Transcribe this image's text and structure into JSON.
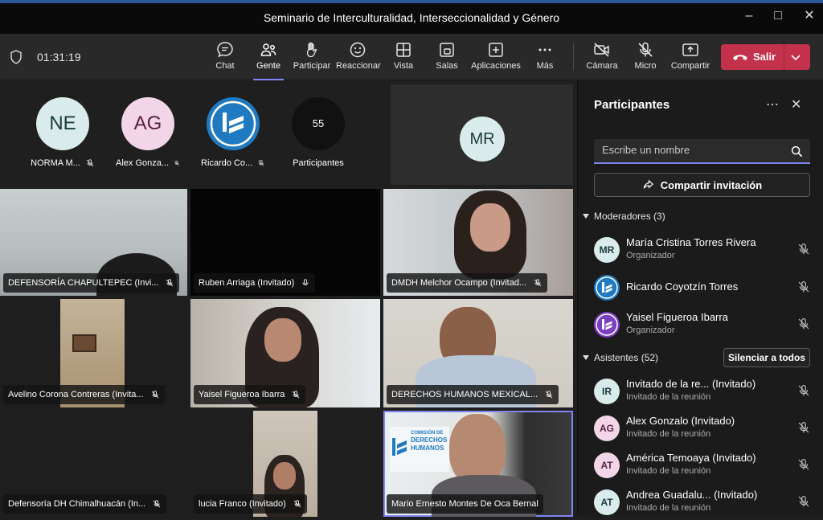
{
  "window": {
    "title": "Seminario de Interculturalidad, Interseccionalidad y Género"
  },
  "toolbar": {
    "timer": "01:31:19",
    "buttons": [
      {
        "label": "Chat",
        "icon": "chat-icon"
      },
      {
        "label": "Gente",
        "icon": "people-icon",
        "active": true
      },
      {
        "label": "Participar",
        "icon": "raise-hand-icon"
      },
      {
        "label": "Reaccionar",
        "icon": "smiley-icon"
      },
      {
        "label": "Vista",
        "icon": "grid-icon"
      },
      {
        "label": "Salas",
        "icon": "rooms-icon"
      },
      {
        "label": "Aplicaciones",
        "icon": "add-app-icon"
      },
      {
        "label": "Más",
        "icon": "more-icon"
      },
      {
        "label": "Cámara",
        "icon": "camera-off-icon"
      },
      {
        "label": "Micro",
        "icon": "mic-off-icon"
      },
      {
        "label": "Compartir",
        "icon": "share-screen-icon"
      }
    ],
    "leave_label": "Salir"
  },
  "stage": {
    "avatars": [
      {
        "initials": "NE",
        "name": "NORMA M...",
        "bg": "#d9ebeb",
        "fg": "#1b3a3a"
      },
      {
        "initials": "AG",
        "name": "Alex Gonza...",
        "bg": "#f2d6e8",
        "fg": "#5a2040"
      },
      {
        "initials": "",
        "name": "Ricardo Co...",
        "bg": "#1f7ac2",
        "fg": "#ffffff"
      }
    ],
    "overflow": {
      "count": "55",
      "label": "Participantes"
    },
    "mr_tile": {
      "initials": "MR"
    },
    "tiles": [
      {
        "label": "DEFENSORÍA CHAPULTEPEC (Invi...",
        "mic": "muted"
      },
      {
        "label": "Ruben Arriaga (Invitado)",
        "mic": "on"
      },
      {
        "label": "DMDH Melchor Ocampo (Invitad...",
        "mic": "muted"
      },
      {
        "label": "Avelino Corona Contreras (Invita...",
        "mic": "muted"
      },
      {
        "label": "Yaisel Figueroa Ibarra",
        "mic": "muted"
      },
      {
        "label": "DERECHOS HUMANOS MEXICAL...",
        "mic": "muted"
      },
      {
        "label": "Defensoría DH Chimalhuacán (In...",
        "mic": "muted"
      },
      {
        "label": "lucia Franco (Invitado)",
        "mic": "muted"
      },
      {
        "label": "Mario Ernesto Montes De Oca Bernal",
        "mic": "none"
      }
    ],
    "banner_text": [
      "COMISIÓN DE",
      "DERECHOS",
      "HUMANOS"
    ]
  },
  "panel": {
    "title": "Participantes",
    "search_placeholder": "Escribe un nombre",
    "share_label": "Compartir invitación",
    "moderators_header": "Moderadores (3)",
    "attendees_header": "Asistentes (52)",
    "mute_all_label": "Silenciar a todos",
    "moderators": [
      {
        "initials": "MR",
        "name": "María Cristina Torres Rivera",
        "role": "Organizador",
        "bg": "#d9ebeb",
        "fg": "#1b3a3a"
      },
      {
        "initials": "",
        "name": "Ricardo Coyotzín Torres",
        "role": "",
        "bg": "#1f7ac2",
        "fg": "#ffffff"
      },
      {
        "initials": "",
        "name": "Yaisel Figueroa Ibarra",
        "role": "Organizador",
        "bg": "#7b3fc4",
        "fg": "#ffffff"
      }
    ],
    "attendees": [
      {
        "initials": "IR",
        "name": "Invitado de la re...  (Invitado)",
        "role": "Invitado de la reunión",
        "bg": "#d9ebeb",
        "fg": "#1b3a3a"
      },
      {
        "initials": "AG",
        "name": "Alex Gonzalo (Invitado)",
        "role": "Invitado de la reunión",
        "bg": "#f2d6e8",
        "fg": "#5a2040"
      },
      {
        "initials": "AT",
        "name": "América Temoaya (Invitado)",
        "role": "Invitado de la reunión",
        "bg": "#f2d6e8",
        "fg": "#5a2040"
      },
      {
        "initials": "AT",
        "name": "Andrea Guadalu...  (Invitado)",
        "role": "Invitado de la reunión",
        "bg": "#d9ebeb",
        "fg": "#1b3a3a"
      }
    ]
  },
  "colors": {
    "accent": "#7f85f5",
    "leave": "#c4314b"
  }
}
